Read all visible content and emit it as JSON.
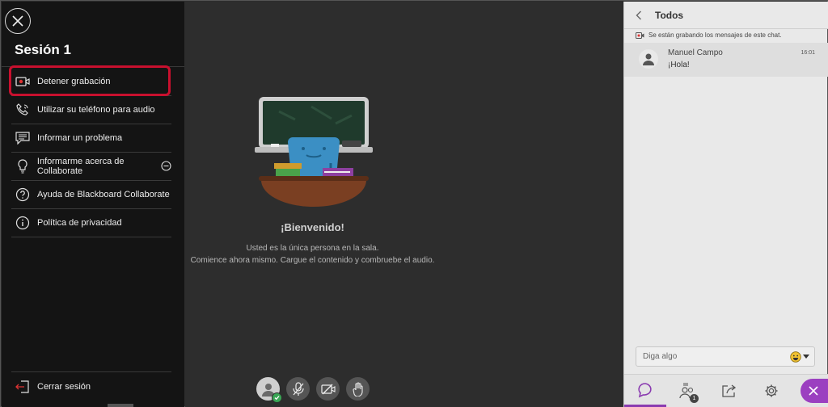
{
  "menu": {
    "session_title": "Sesión 1",
    "items": [
      {
        "label": "Detener grabación",
        "icon": "record-icon"
      },
      {
        "label": "Utilizar su teléfono para audio",
        "icon": "phone-icon"
      },
      {
        "label": "Informar un problema",
        "icon": "report-icon"
      },
      {
        "label": "Informarme acerca de Collaborate",
        "icon": "lightbulb-icon"
      },
      {
        "label": "Ayuda de Blackboard Collaborate",
        "icon": "help-icon"
      },
      {
        "label": "Política de privacidad",
        "icon": "info-icon"
      }
    ],
    "logout_label": "Cerrar sesión"
  },
  "stage": {
    "welcome": "¡Bienvenido!",
    "line1": "Usted es la única persona en la sala.",
    "line2": "Comience ahora mismo. Cargue el contenido y combruebe el audio."
  },
  "chat": {
    "title": "Todos",
    "recording_notice": "Se están grabando los mensajes de este chat.",
    "messages": [
      {
        "author": "Manuel Campo",
        "time": "16:01",
        "text": "¡Hola!"
      }
    ],
    "input_placeholder": "Diga algo",
    "attendee_count": "1"
  },
  "colors": {
    "accent": "#9b3fc0",
    "highlight": "#c8102e"
  }
}
